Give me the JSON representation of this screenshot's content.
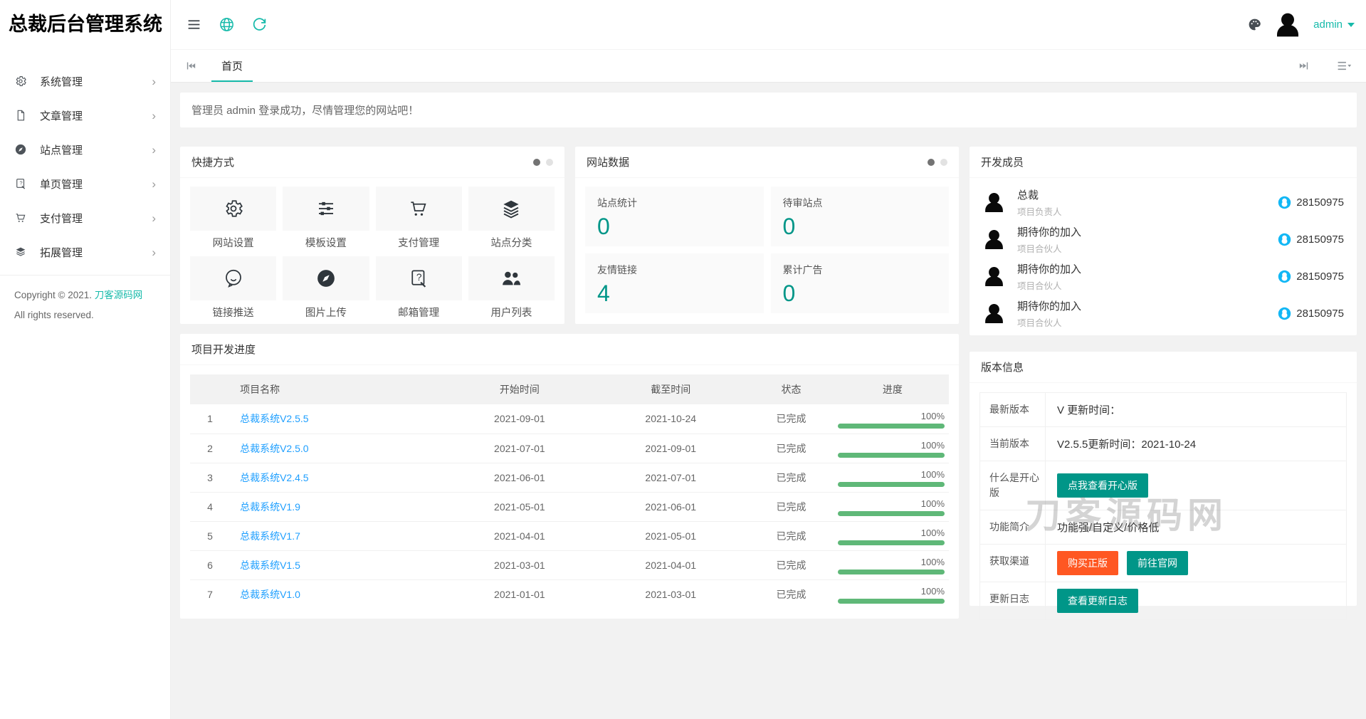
{
  "app": {
    "title": "总裁后台管理系统"
  },
  "topbar": {
    "user": "admin"
  },
  "tabbar": {
    "home": "首页"
  },
  "welcome": {
    "text": "管理员 admin 登录成功，尽情管理您的网站吧！"
  },
  "sidebar": {
    "items": [
      {
        "label": "系统管理"
      },
      {
        "label": "文章管理"
      },
      {
        "label": "站点管理"
      },
      {
        "label": "单页管理"
      },
      {
        "label": "支付管理"
      },
      {
        "label": "拓展管理"
      }
    ],
    "copyright": {
      "line1_prefix": "Copyright © 2021.",
      "line1_link": "刀客源码网",
      "line2": "All rights reserved."
    }
  },
  "shortcuts": {
    "title": "快捷方式",
    "items": [
      {
        "label": "网站设置"
      },
      {
        "label": "模板设置"
      },
      {
        "label": "支付管理"
      },
      {
        "label": "站点分类"
      },
      {
        "label": "链接推送"
      },
      {
        "label": "图片上传"
      },
      {
        "label": "邮箱管理"
      },
      {
        "label": "用户列表"
      }
    ]
  },
  "site_data": {
    "title": "网站数据",
    "stats": [
      {
        "label": "站点统计",
        "value": "0"
      },
      {
        "label": "待审站点",
        "value": "0"
      },
      {
        "label": "友情链接",
        "value": "4"
      },
      {
        "label": "累计广告",
        "value": "0"
      }
    ]
  },
  "members": {
    "title": "开发成员",
    "items": [
      {
        "name": "总裁",
        "role": "项目负责人",
        "qq": "28150975"
      },
      {
        "name": "期待你的加入",
        "role": "项目合伙人",
        "qq": "28150975"
      },
      {
        "name": "期待你的加入",
        "role": "项目合伙人",
        "qq": "28150975"
      },
      {
        "name": "期待你的加入",
        "role": "项目合伙人",
        "qq": "28150975"
      }
    ]
  },
  "projects": {
    "title": "项目开发进度",
    "headers": {
      "name": "项目名称",
      "start": "开始时间",
      "end": "截至时间",
      "status": "状态",
      "progress": "进度"
    },
    "rows": [
      {
        "index": "1",
        "name": "总裁系统V2.5.5",
        "start": "2021-09-01",
        "end": "2021-10-24",
        "status": "已完成",
        "progress": "100%"
      },
      {
        "index": "2",
        "name": "总裁系统V2.5.0",
        "start": "2021-07-01",
        "end": "2021-09-01",
        "status": "已完成",
        "progress": "100%"
      },
      {
        "index": "3",
        "name": "总裁系统V2.4.5",
        "start": "2021-06-01",
        "end": "2021-07-01",
        "status": "已完成",
        "progress": "100%"
      },
      {
        "index": "4",
        "name": "总裁系统V1.9",
        "start": "2021-05-01",
        "end": "2021-06-01",
        "status": "已完成",
        "progress": "100%"
      },
      {
        "index": "5",
        "name": "总裁系统V1.7",
        "start": "2021-04-01",
        "end": "2021-05-01",
        "status": "已完成",
        "progress": "100%"
      },
      {
        "index": "6",
        "name": "总裁系统V1.5",
        "start": "2021-03-01",
        "end": "2021-04-01",
        "status": "已完成",
        "progress": "100%"
      },
      {
        "index": "7",
        "name": "总裁系统V1.0",
        "start": "2021-01-01",
        "end": "2021-03-01",
        "status": "已完成",
        "progress": "100%"
      }
    ]
  },
  "version": {
    "title": "版本信息",
    "watermark": "刀客源码网",
    "rows": {
      "latest": {
        "label": "最新版本",
        "value": "V 更新时间："
      },
      "current": {
        "label": "当前版本",
        "value": "V2.5.5更新时间：2021-10-24"
      },
      "happy": {
        "label": "什么是开心版",
        "button": "点我查看开心版"
      },
      "features": {
        "label": "功能简介",
        "value": "功能强/自定义/价格低"
      },
      "channel": {
        "label": "获取渠道",
        "buy_button": "购买正版",
        "official_button": "前往官网"
      },
      "changelog": {
        "label": "更新日志",
        "button": "查看更新日志"
      }
    }
  },
  "colors": {
    "accent_teal": "#16baaa",
    "button_teal": "#009688",
    "button_orange": "#ff5722",
    "link_blue": "#1e9fff",
    "status_red": "#ff5722",
    "status_green": "#5fb878",
    "progress_green": "#5fb878",
    "qq_blue": "#12b7f5",
    "stat_number_teal": "#009688"
  }
}
